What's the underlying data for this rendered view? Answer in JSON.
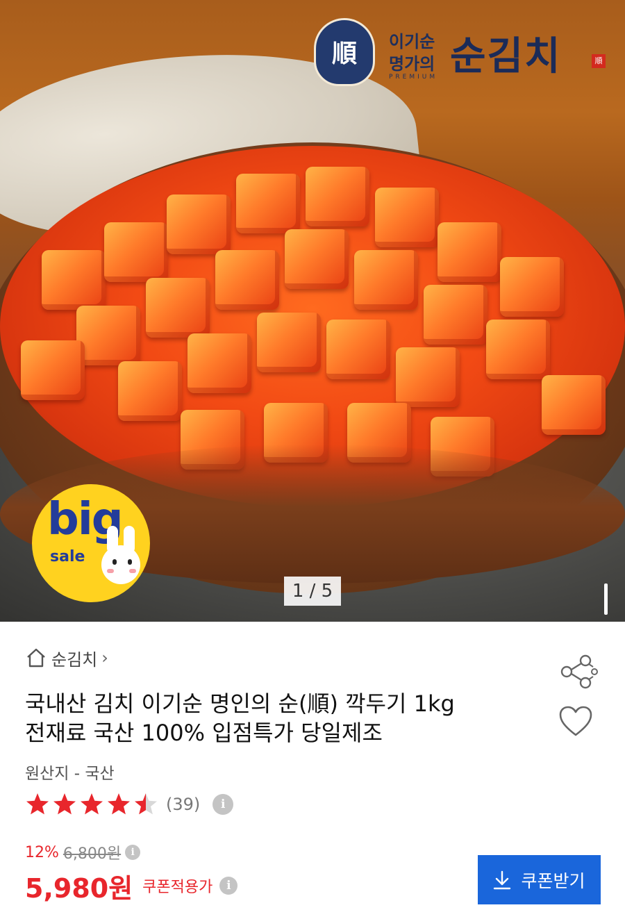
{
  "hero": {
    "brand": {
      "seal_char": "順",
      "line1": "이기순",
      "line2": "명가의",
      "tagline": "PREMIUM",
      "name": "순김치",
      "stamp": "順"
    },
    "badge": {
      "big": "big",
      "sale": "sale"
    },
    "counter": "1 / 5"
  },
  "store": {
    "home_icon": "home-icon",
    "name": "순김치",
    "chevron": "›"
  },
  "product": {
    "title_line1": "국내산 김치 이기순 명인의 순(順) 깍두기 1kg",
    "title_line2": "전재료 국산 100% 입점특가 당일제조",
    "origin": "원산지 - 국산",
    "rating": {
      "stars": 4.5,
      "count": "(39)"
    }
  },
  "pricing": {
    "discount": "12%",
    "original": "6,800원",
    "price": "5,980원",
    "note": "쿠폰적용가"
  },
  "actions": {
    "share_icon": "share-icon",
    "wishlist_icon": "heart-icon",
    "coupon_label": "쿠폰받기",
    "info_glyph": "i"
  },
  "colors": {
    "accent_red": "#e8262c",
    "coupon_blue": "#1a66db",
    "star_red": "#e8262c"
  }
}
